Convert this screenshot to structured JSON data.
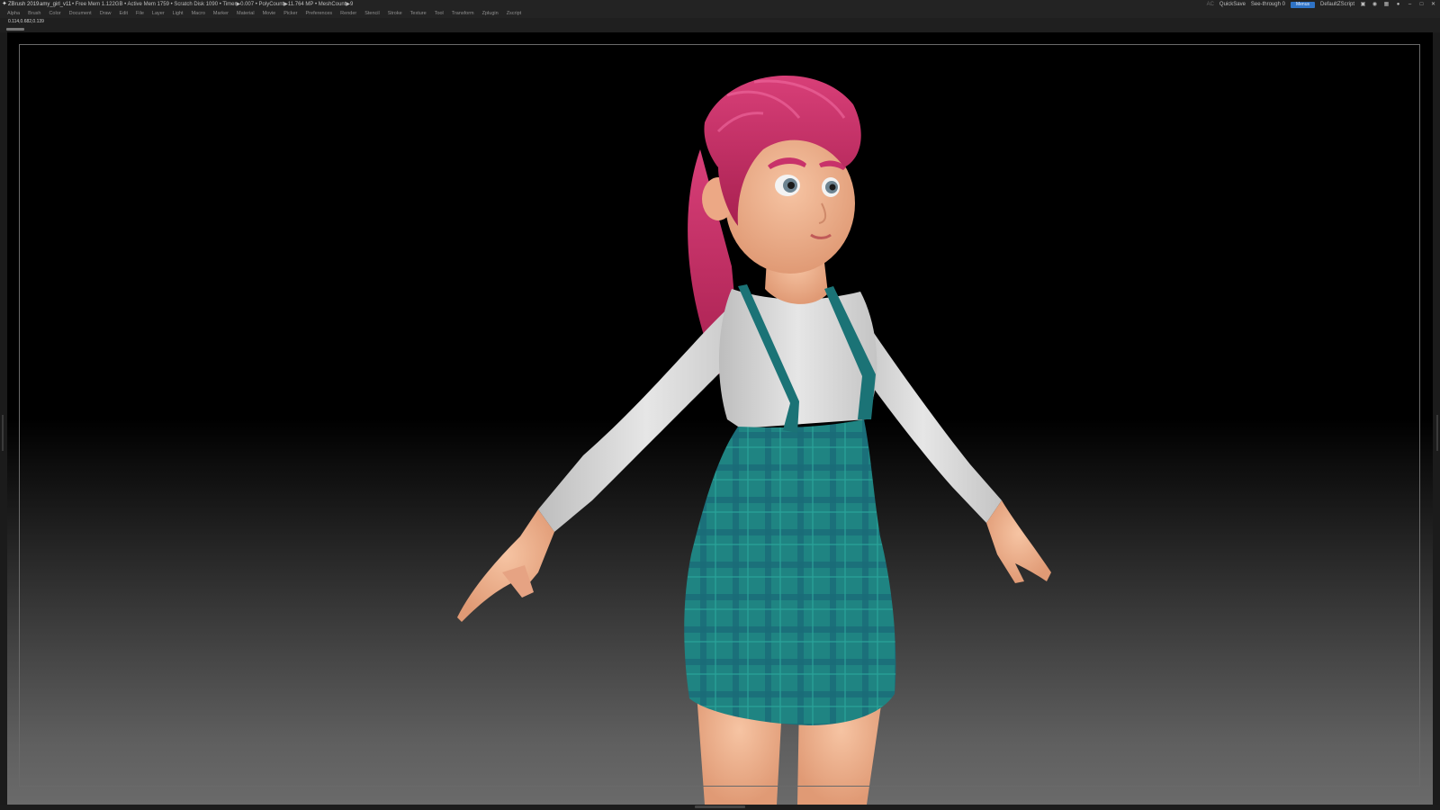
{
  "titlebar": {
    "app": "ZBrush 2019",
    "project": "amy_girl_v11",
    "stats": "• Free Mem 1.122GB • Active Mem 1759 • Scratch Disk 1090 • Timer▶0.007 • PolyCount▶11.764 MP • MeshCount▶9",
    "ac": "AC",
    "quicksave": "QuickSave",
    "see_through_label": "See-through",
    "see_through_value": "0",
    "see_through_level": 0.0,
    "menus": "Menus",
    "script": "DefaultZScript"
  },
  "menubar": {
    "items": [
      "Alpha",
      "Brush",
      "Color",
      "Document",
      "Draw",
      "Edit",
      "File",
      "Layer",
      "Light",
      "Macro",
      "Marker",
      "Material",
      "Movie",
      "Picker",
      "Preferences",
      "Render",
      "Stencil",
      "Stroke",
      "Texture",
      "Tool",
      "Transform",
      "Zplugin",
      "Zscript"
    ]
  },
  "subbar": {
    "coords": "0.114,0.682,0.139"
  },
  "colors": {
    "hair": "#c8326a",
    "skin": "#f0b28e",
    "shirt": "#dcdcdc",
    "dress": "#1e7f80",
    "menus_blue": "#2f73c6"
  },
  "icons": [
    "z-logo-icon",
    "window-icon",
    "palette-icon",
    "layout-icon",
    "lock-icon",
    "minimize-icon",
    "restore-icon",
    "close-icon"
  ]
}
